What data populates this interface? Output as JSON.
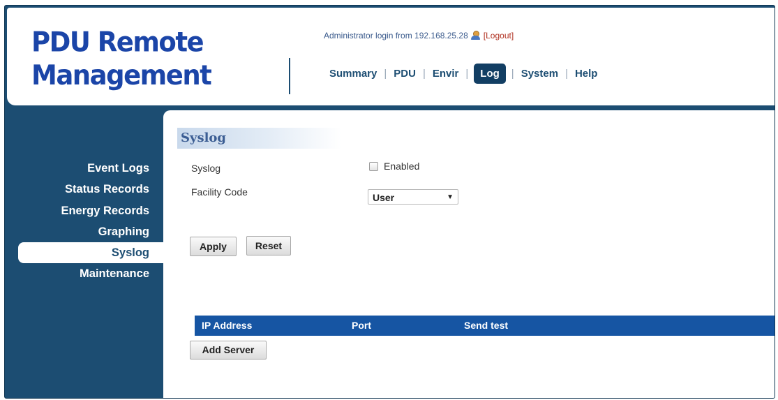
{
  "header": {
    "logo_line1": "PDU Remote",
    "logo_line2": "Management",
    "login_text": "Administrator login from 192.168.25.28",
    "logout_label": "[Logout]"
  },
  "topnav": {
    "items": [
      "Summary",
      "PDU",
      "Envir",
      "Log",
      "System",
      "Help"
    ],
    "active": "Log"
  },
  "sidebar": {
    "items": [
      "Event Logs",
      "Status Records",
      "Energy Records",
      "Graphing",
      "Syslog",
      "Maintenance"
    ],
    "active": "Syslog"
  },
  "main": {
    "section_title": "Syslog",
    "syslog_label": "Syslog",
    "enabled_label": "Enabled",
    "enabled_checked": false,
    "facility_label": "Facility Code",
    "facility_value": "User",
    "apply_label": "Apply",
    "reset_label": "Reset",
    "table": {
      "columns": [
        "IP Address",
        "Port",
        "Send test"
      ]
    },
    "add_server_label": "Add Server"
  },
  "colors": {
    "brand_blue": "#1b45a8",
    "navy": "#1c4d72",
    "table_header": "#1655a3"
  }
}
